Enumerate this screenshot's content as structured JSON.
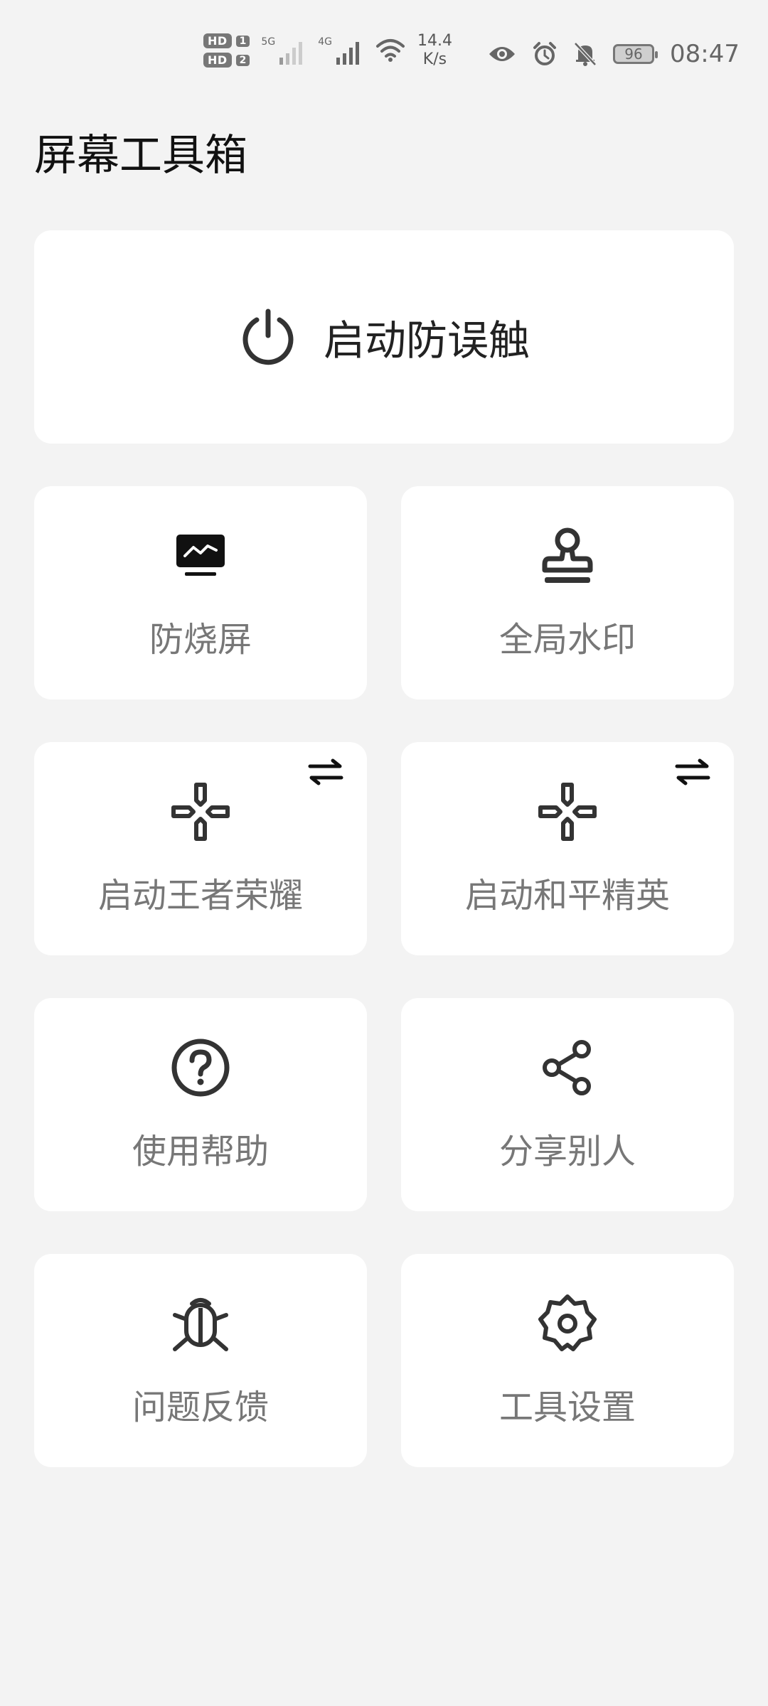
{
  "status_bar": {
    "sim1": "1",
    "sim2": "2",
    "hd": "HD",
    "net1": "5G",
    "net2": "4G",
    "speed_value": "14.4",
    "speed_unit": "K/s",
    "battery": "96",
    "time": "08:47"
  },
  "page": {
    "title": "屏幕工具箱"
  },
  "main_action": {
    "label": "启动防误触",
    "icon": "power-icon"
  },
  "tiles": [
    {
      "label": "防烧屏",
      "icon": "monitor-icon"
    },
    {
      "label": "全局水印",
      "icon": "stamp-icon"
    },
    {
      "label": "启动王者荣耀",
      "icon": "gamepad-icon",
      "switch_icon": "swap-icon"
    },
    {
      "label": "启动和平精英",
      "icon": "gamepad-icon",
      "switch_icon": "swap-icon"
    },
    {
      "label": "使用帮助",
      "icon": "help-icon"
    },
    {
      "label": "分享别人",
      "icon": "share-icon"
    },
    {
      "label": "问题反馈",
      "icon": "bug-icon"
    },
    {
      "label": "工具设置",
      "icon": "gear-icon"
    }
  ],
  "colors": {
    "background": "#f3f3f3",
    "card": "#ffffff",
    "icon": "#333333",
    "label_muted": "#777777"
  }
}
